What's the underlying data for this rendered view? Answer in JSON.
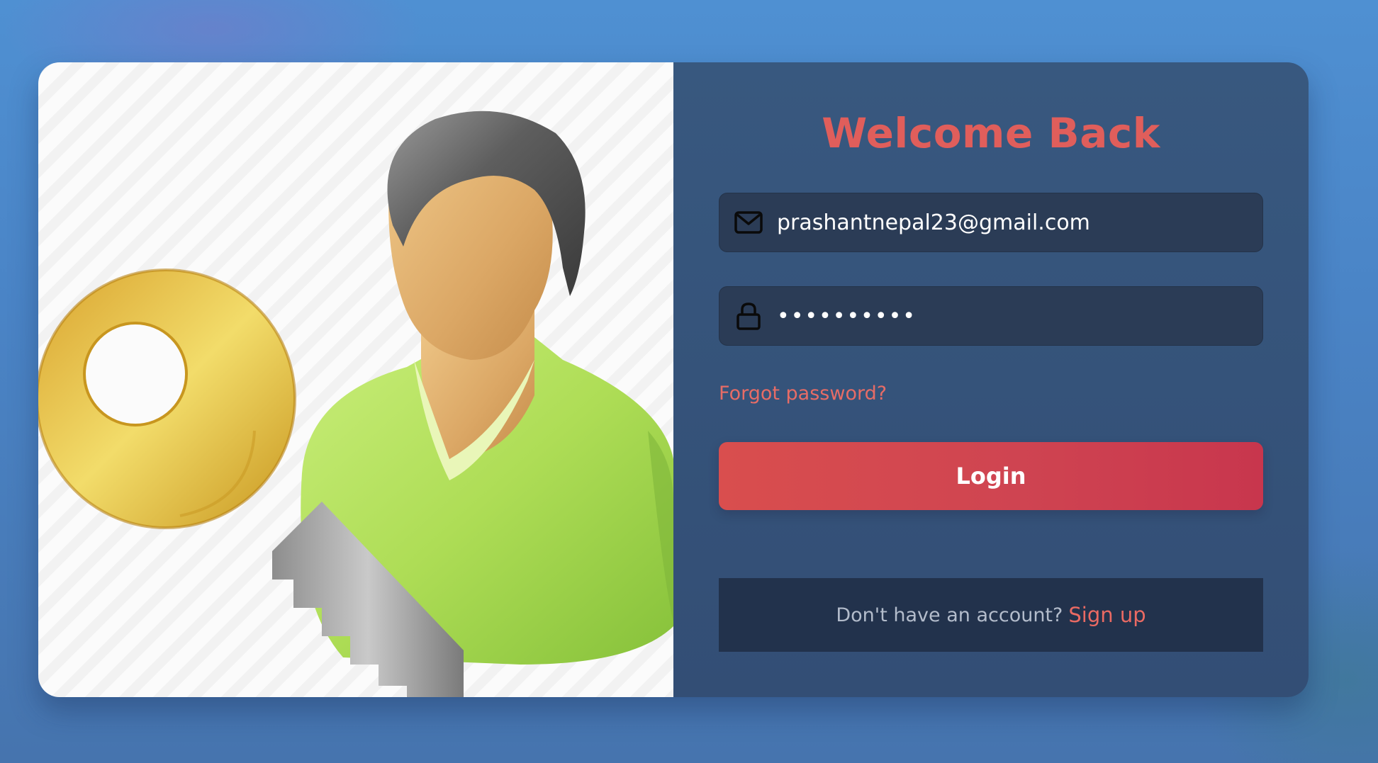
{
  "illustration": {
    "icon": "user-with-key-icon"
  },
  "login_form": {
    "title": "Welcome Back",
    "email": {
      "icon": "envelope-icon",
      "value": "prashantnepal23@gmail.com"
    },
    "password": {
      "icon": "lock-icon",
      "value": "••••••••••"
    },
    "forgot_password_label": "Forgot password?",
    "login_label": "Login",
    "footer": {
      "prompt": "Don't have an account?",
      "signup_label": "Sign up"
    }
  },
  "colors": {
    "accent": "#e05e5b",
    "button_start": "#d94e4e",
    "button_end": "#c8364d",
    "panel": "#35537a",
    "field": "#2b3c56",
    "footer": "#22324c"
  }
}
